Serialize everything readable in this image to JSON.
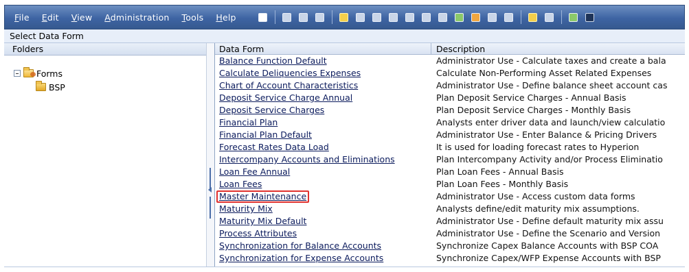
{
  "menubar": {
    "items": [
      {
        "label_u": "F",
        "label_rest": "ile"
      },
      {
        "label_u": "E",
        "label_rest": "dit"
      },
      {
        "label_u": "V",
        "label_rest": "iew"
      },
      {
        "label_u": "A",
        "label_rest": "dministration"
      },
      {
        "label_u": "T",
        "label_rest": "ools"
      },
      {
        "label_u": "H",
        "label_rest": "elp"
      }
    ],
    "toolbar_icons": [
      "outline-icon",
      "grid-icon",
      "refresh-icon",
      "print-icon",
      "edit-icon",
      "lock-icon",
      "chart-icon",
      "adjust-icon",
      "copy-icon",
      "paste-icon",
      "calc-icon",
      "validate-icon",
      "rules-icon",
      "list-icon",
      "flag-icon",
      "clipboard-icon",
      "notes-icon",
      "exit-icon",
      "help-icon"
    ],
    "accent_color": "#3e64a3"
  },
  "title": "Select Data Form",
  "folders": {
    "header": "Folders",
    "tree": [
      {
        "label": "Forms",
        "level": 0
      },
      {
        "label": "BSP",
        "level": 1
      }
    ]
  },
  "grid": {
    "headers": {
      "form": "Data Form",
      "description": "Description"
    },
    "rows": [
      {
        "form": "Balance Function Default",
        "description": "Administrator Use - Calculate taxes and create a bala"
      },
      {
        "form": "Calculate Deliquencies Expenses",
        "description": "Calculate Non-Performing Asset Related Expenses"
      },
      {
        "form": "Chart of Account Characteristics",
        "description": "Administrator Use - Define balance sheet account cas"
      },
      {
        "form": "Deposit Service Charge Annual",
        "description": "Plan Deposit Service Charges - Annual Basis"
      },
      {
        "form": "Deposit Service Charges",
        "description": "Plan Deposit Service Charges - Monthly Basis"
      },
      {
        "form": "Financial Plan",
        "description": "Analysts enter driver data and launch/view calculatio"
      },
      {
        "form": "Financial Plan Default",
        "description": "Administrator Use - Enter Balance & Pricing Drivers"
      },
      {
        "form": "Forecast Rates Data Load",
        "description": "It is used for loading forecast rates to Hyperion"
      },
      {
        "form": "Intercompany Accounts and Eliminations",
        "description": "Plan Intercompany Activity and/or Process Eliminatio"
      },
      {
        "form": "Loan Fee Annual",
        "description": "Plan Loan Fees - Annual Basis"
      },
      {
        "form": "Loan Fees",
        "description": "Plan Loan Fees - Monthly Basis"
      },
      {
        "form": "Master Maintenance",
        "description": "Administrator Use - Access custom data forms",
        "highlighted": true
      },
      {
        "form": "Maturity Mix",
        "description": "Analysts define/edit maturity mix assumptions."
      },
      {
        "form": "Maturity Mix Default",
        "description": "Administrator Use - Define default maturity mix assu"
      },
      {
        "form": "Process Attributes",
        "description": "Administrator Use - Define the Scenario and Version"
      },
      {
        "form": "Synchronization for Balance Accounts",
        "description": "Synchronize Capex Balance Accounts with BSP COA"
      },
      {
        "form": "Synchronization for Expense Accounts",
        "description": "Synchronize Capex/WFP Expense Accounts with BSP"
      }
    ],
    "highlight_color": "#e0302d"
  }
}
